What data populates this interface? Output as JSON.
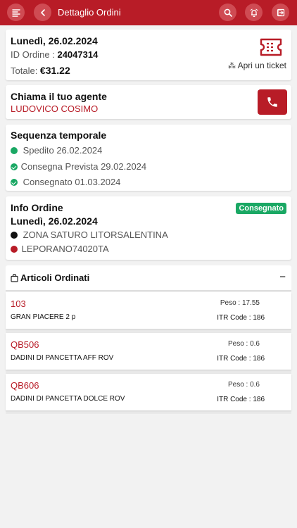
{
  "header": {
    "title": "Dettaglio Ordini"
  },
  "order": {
    "date": "Lunedì, 26.02.2024",
    "id_label": "ID Ordine : ",
    "id_value": "24047314",
    "total_label": "Totale: ",
    "total_value": "€31.22",
    "ticket_label": "Apri un ticket"
  },
  "agent": {
    "title": "Chiama il tuo agente",
    "name": "LUDOVICO COSIMO"
  },
  "timeline": {
    "title": "Sequenza temporale",
    "items": [
      {
        "text": "Spedito 26.02.2024",
        "status_color": "#1aa864"
      },
      {
        "text": "Consegna Prevista 29.02.2024",
        "status_color": "#1aa864"
      },
      {
        "text": "Consegnato 01.03.2024",
        "status_color": "#1aa864"
      }
    ]
  },
  "info": {
    "title": "Info Ordine",
    "badge": "Consegnato",
    "date": "Lunedì, 26.02.2024",
    "from": "ZONA SATURO LITORSALENTINA",
    "to": "LEPORANO74020TA"
  },
  "articles": {
    "title": "Articoli Ordinati",
    "collapse_symbol": "−",
    "items": [
      {
        "code": "103",
        "name": "GRAN PIACERE 2 p",
        "peso": "Peso : 17.55",
        "itr": "ITR Code : 186"
      },
      {
        "code": "QB506",
        "name": "DADINI DI PANCETTA AFF ROV",
        "peso": "Peso : 0.6",
        "itr": "ITR Code : 186"
      },
      {
        "code": "QB606",
        "name": "DADINI DI PANCETTA DOLCE ROV",
        "peso": "Peso : 0.6",
        "itr": "ITR Code : 186"
      }
    ]
  },
  "colors": {
    "brand": "#b81c27",
    "success": "#1aa864"
  },
  "icons": [
    "menu-icon",
    "back-icon",
    "search-icon",
    "bell-icon",
    "logout-icon",
    "ticket-icon",
    "phone-icon",
    "bag-icon"
  ]
}
